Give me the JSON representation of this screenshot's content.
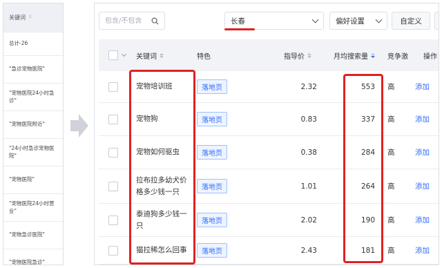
{
  "left_panel": {
    "header": "关键词",
    "total": "总计-26",
    "keywords": [
      "\"急诊宠物医院\"",
      "\"宠物医院24小时急诊\"",
      "\"宠物医院附近\"",
      "\"24小时急诊宠物医院\"",
      "\"宠物医院\"",
      "\"宠物医院24小时营业\"",
      "\"宠物急诊医院\"",
      "\"宠物医院急诊\""
    ]
  },
  "toolbar": {
    "search_placeholder": "包含/不包含",
    "city": "长春",
    "preferences": "偏好设置",
    "custom": "自定义"
  },
  "table": {
    "headers": {
      "keyword": "关键词",
      "feature": "特色",
      "price": "指导价",
      "monthly_search": "月均搜索量",
      "competition": "竞争激",
      "action": "操作"
    },
    "rows": [
      {
        "keyword": "宠物培训班",
        "feature": "落地页",
        "price": "2.32",
        "searches": "553",
        "competition": "高",
        "action": "添加"
      },
      {
        "keyword": "宠物狗",
        "feature": "落地页",
        "price": "0.83",
        "searches": "337",
        "competition": "高",
        "action": "添加"
      },
      {
        "keyword": "宠物如何驱虫",
        "feature": "落地页",
        "price": "0.38",
        "searches": "284",
        "competition": "高",
        "action": "添加"
      },
      {
        "keyword": "拉布拉多幼犬价格多少钱一只",
        "feature": "落地页",
        "price": "1.01",
        "searches": "264",
        "competition": "高",
        "action": "添加"
      },
      {
        "keyword": "泰迪狗多少钱一只",
        "feature": "落地页",
        "price": "2.02",
        "searches": "190",
        "competition": "高",
        "action": "添加"
      },
      {
        "keyword": "猫拉稀怎么回事",
        "feature": "落地页",
        "price": "2.43",
        "searches": "181",
        "competition": "高",
        "action": "添加"
      }
    ]
  },
  "colors": {
    "accent": "#2f6bff",
    "annotation": "#e02020",
    "header_bg": "#f2f3f7"
  }
}
